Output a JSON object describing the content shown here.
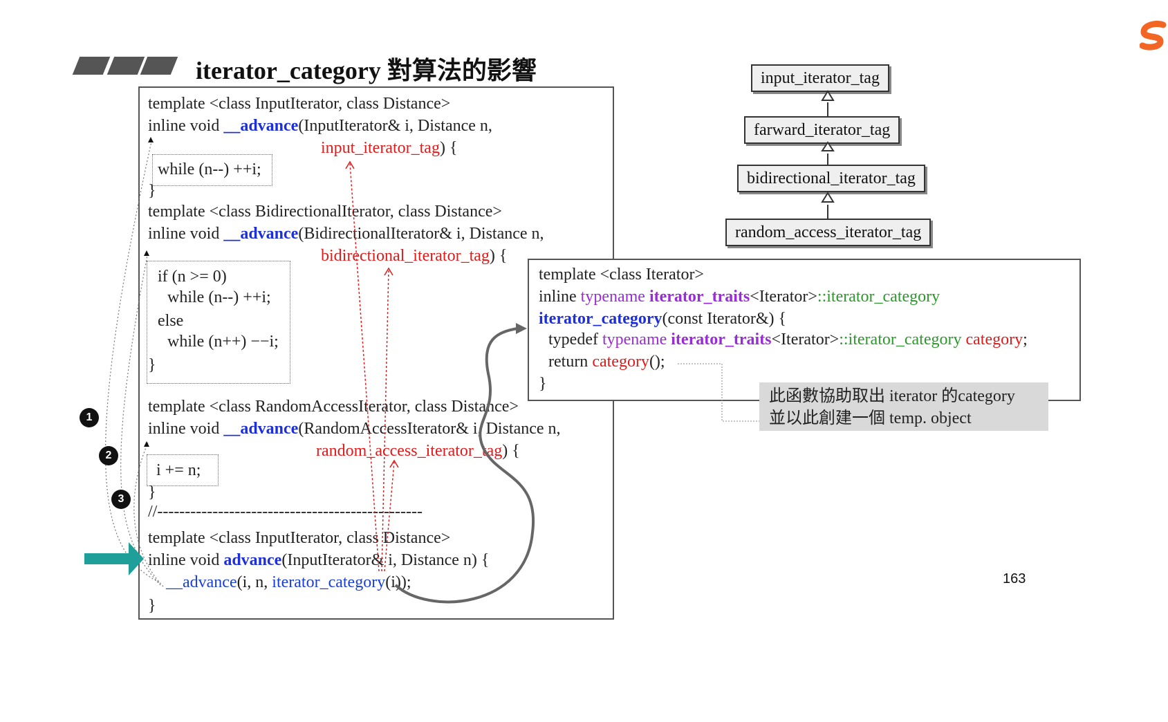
{
  "header": {
    "title": "iterator_category 對算法的影響"
  },
  "main_code": {
    "l1": "template <class InputIterator, class Distance>",
    "l2_pre": "inline void ",
    "l2_fn": "__advance",
    "l2_post": "(InputIterator& i, Distance n,",
    "l3_tag": "input_iterator_tag",
    "l3_post": ") {",
    "l4": "while (n--) ++i;",
    "l5": "}",
    "l6": "template <class BidirectionalIterator, class Distance>",
    "l7_pre": "inline void ",
    "l7_fn": "__advance",
    "l7_post": "(BidirectionalIterator& i, Distance n,",
    "l8_tag": "bidirectional_iterator_tag",
    "l8_post": ") {",
    "l9": "if (n >= 0)",
    "l10": "while (n--) ++i;",
    "l11": "else",
    "l12": "while (n++) −−i;",
    "l13": "}",
    "l14": "template <class RandomAccessIterator, class Distance>",
    "l15_pre": "inline void ",
    "l15_fn": "__advance",
    "l15_post": "(RandomAccessIterator& i, Distance n,",
    "l16_tag": "random_access_iterator_tag",
    "l16_post": ") {",
    "l17": "i += n;",
    "l18": "}",
    "l19": "//------------------------------------------------",
    "l20": "template <class InputIterator, class Distance>",
    "l21_pre": "inline void ",
    "l21_fn": "advance",
    "l21_post": "(InputIterator& i, Distance n) {",
    "l22_fn": "__advance",
    "l22_mid": "(i, n, ",
    "l22_call": "iterator_category",
    "l22_post": "(i));",
    "l23": "}"
  },
  "hierarchy": {
    "tags": [
      "input_iterator_tag",
      "farward_iterator_tag",
      "bidirectional_iterator_tag",
      "random_access_iterator_tag"
    ]
  },
  "right_code": {
    "r1": "template <class Iterator>",
    "r2_pre": "inline ",
    "r2_typename": "typename ",
    "r2_traits": "iterator_traits",
    "r2_mid": "<Iterator>",
    "r2_post": "::iterator_category",
    "r3_fn": "iterator_category",
    "r3_post": "(const Iterator&) {",
    "r4_pre": "typedef ",
    "r4_typename": "typename ",
    "r4_traits": "iterator_traits",
    "r4_mid": "<Iterator>",
    "r4_cat": "::iterator_category ",
    "r4_var": "category",
    "r4_post": ";",
    "r5_pre": "return ",
    "r5_call": "category",
    "r5_post": "();",
    "r6": "}"
  },
  "note": {
    "line1": "此函數協助取出 iterator 的category",
    "line2": "並以此創建一個 temp. object"
  },
  "badges": [
    "1",
    "2",
    "3"
  ],
  "page_number": "163",
  "logo_icon": "sogou-logo-icon",
  "colors": {
    "function_blue": "#1c2fd8",
    "tag_red": "#e01b1b",
    "traits_purple": "#9a2bd8",
    "category_green": "#2a9a2a",
    "arrow_teal": "#1f9e9a"
  }
}
